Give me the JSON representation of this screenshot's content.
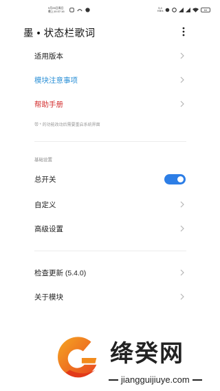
{
  "status_bar": {
    "date_line1": "9月26日周日",
    "date_line2": "晚上10:37:16",
    "net_speed": "5.4 KB/s",
    "battery": "84"
  },
  "app_bar": {
    "title": "墨 • 状态栏歌词",
    "more_icon": "more-vertical-icon"
  },
  "menu_top": [
    {
      "label": "适用版本",
      "color": "#222222"
    },
    {
      "label": "模块注意事项",
      "color": "#2a8fd6"
    },
    {
      "label": "帮助手册",
      "color": "#d32f2f"
    }
  ],
  "note": "带 * 的功能改动后需要重启系统界面",
  "basic_section": {
    "header": "基础设置",
    "items": [
      {
        "label": "总开关",
        "toggle": true
      },
      {
        "label": "自定义"
      },
      {
        "label": "高级设置"
      }
    ]
  },
  "bottom_section": {
    "items": [
      {
        "label": "检查更新 (5.4.0)"
      },
      {
        "label": "关于模块"
      }
    ]
  },
  "toggle_color": "#2d7ee6",
  "watermark": {
    "text": "绛癸网",
    "url": "jiangguijiuye.com"
  }
}
